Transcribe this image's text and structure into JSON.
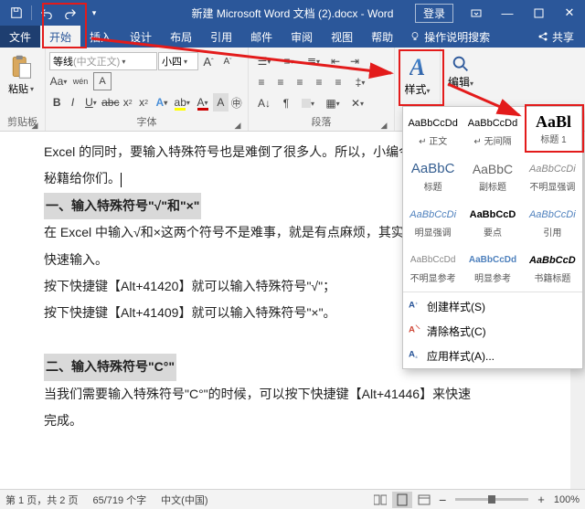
{
  "titlebar": {
    "doc_title": "新建 Microsoft Word 文档 (2).docx - Word",
    "login": "登录"
  },
  "tabs": {
    "file": "文件",
    "home": "开始",
    "insert": "插入",
    "design": "设计",
    "layout": "布局",
    "references": "引用",
    "mailings": "邮件",
    "review": "审阅",
    "view": "视图",
    "help": "帮助",
    "tell_me": "操作说明搜索",
    "share": "共享"
  },
  "ribbon": {
    "clipboard": {
      "paste": "粘贴",
      "label": "剪贴板"
    },
    "font": {
      "name_prefix": "等线",
      "name_suffix": "(中文正文)",
      "size": "小四",
      "label": "字体"
    },
    "paragraph": {
      "label": "段落"
    },
    "styles": {
      "btn": "样式",
      "label": "样式"
    },
    "editing": {
      "btn": "编辑"
    }
  },
  "gallery": {
    "row1": [
      {
        "sample": "AaBbCcDd",
        "name": "↵ 正文",
        "style": "font-size:11px;"
      },
      {
        "sample": "AaBbCcDd",
        "name": "↵ 无间隔",
        "style": "font-size:11px;"
      }
    ],
    "title1": {
      "sample": "AaBl",
      "name": "标题 1"
    },
    "row2": [
      {
        "sample": "AaBbC",
        "name": "标题",
        "style": "font-size:15px;color:#365f91;"
      },
      {
        "sample": "AaBbC",
        "name": "副标题",
        "style": "font-size:14px;color:#666;"
      },
      {
        "sample": "AaBbCcDi",
        "name": "不明显强调",
        "style": "font-size:11px;font-style:italic;color:#888;"
      }
    ],
    "row3": [
      {
        "sample": "AaBbCcDi",
        "name": "明显强调",
        "style": "font-size:11px;font-style:italic;color:#4f81bd;"
      },
      {
        "sample": "AaBbCcD",
        "name": "要点",
        "style": "font-size:11px;font-weight:bold;"
      },
      {
        "sample": "AaBbCcDi",
        "name": "引用",
        "style": "font-size:11px;font-style:italic;color:#4f81bd;"
      }
    ],
    "row4": [
      {
        "sample": "AaBbCcDd",
        "name": "不明显参考",
        "style": "font-size:10px;color:#888;"
      },
      {
        "sample": "AaBbCcDd",
        "name": "明显参考",
        "style": "font-size:10px;color:#4f81bd;font-weight:bold;"
      },
      {
        "sample": "AaBbCcD",
        "name": "书籍标题",
        "style": "font-size:11px;font-weight:bold;font-style:italic;"
      }
    ],
    "create_style": "创建样式(S)",
    "clear_format": "清除格式(C)",
    "apply_style": "应用样式(A)..."
  },
  "document": {
    "p1": "Excel 的同时，要输入特殊符号也是难倒了很多人。所以，小编今天就",
    "p2": "秘籍给你们。",
    "h1": "一、输入特殊符号\"√\"和\"×\"",
    "p3": "在 Excel 中输入√和×这两个符号不是难事，就是有点麻烦，其实可以",
    "p4": "快速输入。",
    "p5": "按下快捷键【Alt+41420】就可以输入特殊符号\"√\"；",
    "p6": "按下快捷键【Alt+41409】就可以输入特殊符号\"×\"。",
    "h2": "二、输入特殊符号\"C°\"",
    "p7": "当我们需要输入特殊符号\"C°\"的时候，可以按下快捷键【Alt+41446】来快速",
    "p8": "完成。"
  },
  "status": {
    "page": "第 1 页，共 2 页",
    "words": "65/719 个字",
    "lang": "中文(中国)",
    "zoom_label": "100%",
    "zoom_plus": "+",
    "zoom_minus": "−"
  }
}
